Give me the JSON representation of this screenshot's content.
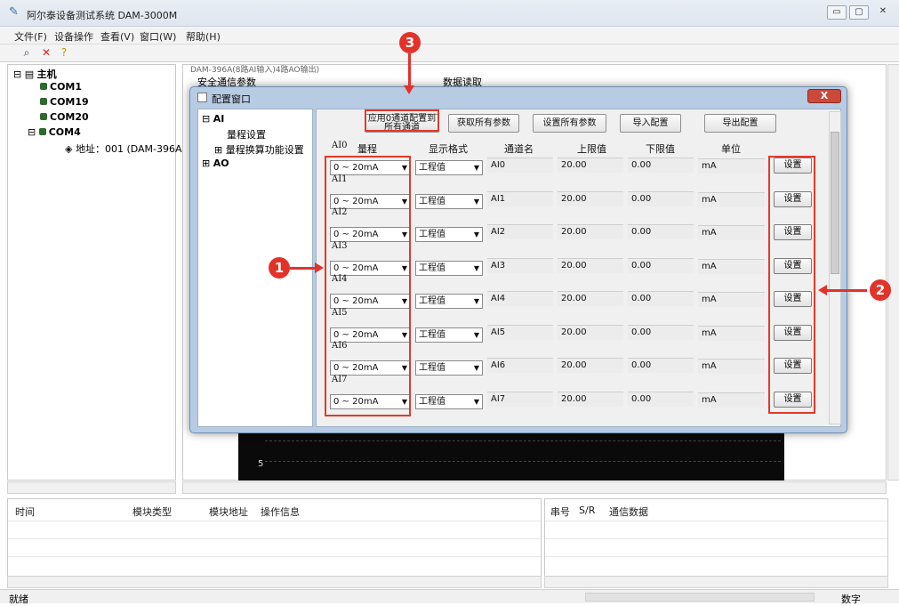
{
  "window": {
    "title": "阿尔泰设备测试系统 DAM-3000M",
    "controls": [
      "▭",
      "▢",
      "✕"
    ]
  },
  "menu": [
    "文件(F)",
    "设备操作",
    "查看(V)",
    "窗口(W)",
    "帮助(H)"
  ],
  "tree": {
    "root": "主机",
    "ports": [
      "COM1",
      "COM19",
      "COM20",
      "COM4"
    ],
    "device": "地址：001 (DAM-396A)"
  },
  "background": {
    "truncated_title": "DAM-396A(8路AI输入)4路AO输出)",
    "safe_params": "安全通信参数",
    "data_read": "数据读取",
    "osc_label": "5"
  },
  "log": {
    "left_headers": [
      "时间",
      "模块类型",
      "模块地址",
      "操作信息"
    ],
    "right_headers": [
      "串号",
      "S/R",
      "通信数据"
    ]
  },
  "status": {
    "ready": "就绪",
    "num": "数字"
  },
  "dialog": {
    "title": "配置窗口",
    "tree": {
      "ai": "AI",
      "range_setting": "量程设置",
      "range_convert": "量程换算功能设置",
      "ao": "AO"
    },
    "buttons": {
      "apply_all_line1": "应用0通道配置到",
      "apply_all_line2": "所有通道",
      "get_params": "获取所有参数",
      "set_params": "设置所有参数",
      "import": "导入配置",
      "export": "导出配置"
    },
    "headers": {
      "range": "量程",
      "format": "显示格式",
      "channel": "通道名",
      "upper": "上限值",
      "lower": "下限值",
      "unit": "单位"
    },
    "set_label": "设置",
    "channels": [
      {
        "label": "AI0",
        "range": "0 ~ 20mA",
        "format": "工程值",
        "name": "AI0",
        "upper": "20.00",
        "lower": "0.00",
        "unit": "mA"
      },
      {
        "label": "AI1",
        "range": "0 ~ 20mA",
        "format": "工程值",
        "name": "AI1",
        "upper": "20.00",
        "lower": "0.00",
        "unit": "mA"
      },
      {
        "label": "AI2",
        "range": "0 ~ 20mA",
        "format": "工程值",
        "name": "AI2",
        "upper": "20.00",
        "lower": "0.00",
        "unit": "mA"
      },
      {
        "label": "AI3",
        "range": "0 ~ 20mA",
        "format": "工程值",
        "name": "AI3",
        "upper": "20.00",
        "lower": "0.00",
        "unit": "mA"
      },
      {
        "label": "AI4",
        "range": "0 ~ 20mA",
        "format": "工程值",
        "name": "AI4",
        "upper": "20.00",
        "lower": "0.00",
        "unit": "mA"
      },
      {
        "label": "AI5",
        "range": "0 ~ 20mA",
        "format": "工程值",
        "name": "AI5",
        "upper": "20.00",
        "lower": "0.00",
        "unit": "mA"
      },
      {
        "label": "AI6",
        "range": "0 ~ 20mA",
        "format": "工程值",
        "name": "AI6",
        "upper": "20.00",
        "lower": "0.00",
        "unit": "mA"
      },
      {
        "label": "AI7",
        "range": "0 ~ 20mA",
        "format": "工程值",
        "name": "AI7",
        "upper": "20.00",
        "lower": "0.00",
        "unit": "mA"
      }
    ]
  },
  "annotations": [
    "1",
    "2",
    "3"
  ],
  "colors": {
    "annotation_red": "#e2322a",
    "dialog_frame": "#b7cbe3"
  }
}
